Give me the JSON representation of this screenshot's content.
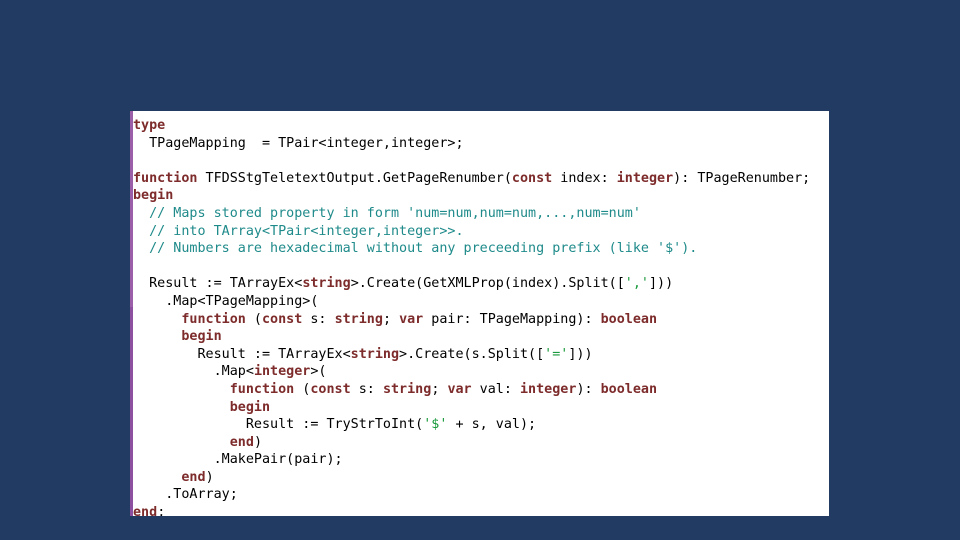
{
  "window": {
    "background_color": "#223b63",
    "panel_background_color": "#ffffff",
    "gutter_color": "#9a5fa8"
  },
  "theme": {
    "keyword_color": "#7d2b2b",
    "identifier_color": "#000000",
    "comment_color": "#1f8a8a",
    "string_color": "#1a9a3c"
  },
  "code": {
    "language": "Delphi / Object Pascal",
    "lines": [
      {
        "indent": 0,
        "tokens": [
          {
            "t": "type",
            "c": "kw"
          }
        ]
      },
      {
        "indent": 0,
        "tokens": [
          {
            "t": "  TPageMapping  = TPair<integer,integer>;",
            "c": "id"
          }
        ]
      },
      {
        "indent": 0,
        "tokens": [
          {
            "t": "",
            "c": "id"
          }
        ]
      },
      {
        "indent": 0,
        "tokens": [
          {
            "t": "function",
            "c": "kw"
          },
          {
            "t": " TFDSStgTeletextOutput.GetPageRenumber(",
            "c": "id"
          },
          {
            "t": "const",
            "c": "kw"
          },
          {
            "t": " index: ",
            "c": "id"
          },
          {
            "t": "integer",
            "c": "kw"
          },
          {
            "t": "): TPageRenumber;",
            "c": "id"
          }
        ]
      },
      {
        "indent": 0,
        "tokens": [
          {
            "t": "begin",
            "c": "kw"
          }
        ]
      },
      {
        "indent": 0,
        "tokens": [
          {
            "t": "  // Maps stored property in form 'num=num,num=num,...,num=num'",
            "c": "cmt"
          }
        ]
      },
      {
        "indent": 0,
        "tokens": [
          {
            "t": "  // into TArray<TPair<integer,integer>>.",
            "c": "cmt"
          }
        ]
      },
      {
        "indent": 0,
        "tokens": [
          {
            "t": "  // Numbers are hexadecimal without any preceeding prefix (like '$').",
            "c": "cmt"
          }
        ]
      },
      {
        "indent": 0,
        "tokens": [
          {
            "t": "",
            "c": "id"
          }
        ]
      },
      {
        "indent": 0,
        "tokens": [
          {
            "t": "  Result := TArrayEx<",
            "c": "id"
          },
          {
            "t": "string",
            "c": "kw"
          },
          {
            "t": ">.Create(GetXMLProp(index).Split([",
            "c": "id"
          },
          {
            "t": "','",
            "c": "str"
          },
          {
            "t": "]))",
            "c": "id"
          }
        ]
      },
      {
        "indent": 0,
        "tokens": [
          {
            "t": "    .Map<TPageMapping>(",
            "c": "id"
          }
        ]
      },
      {
        "indent": 0,
        "tokens": [
          {
            "t": "      ",
            "c": "id"
          },
          {
            "t": "function",
            "c": "kw"
          },
          {
            "t": " (",
            "c": "id"
          },
          {
            "t": "const",
            "c": "kw"
          },
          {
            "t": " s: ",
            "c": "id"
          },
          {
            "t": "string",
            "c": "kw"
          },
          {
            "t": "; ",
            "c": "id"
          },
          {
            "t": "var",
            "c": "kw"
          },
          {
            "t": " pair: TPageMapping): ",
            "c": "id"
          },
          {
            "t": "boolean",
            "c": "kw"
          }
        ]
      },
      {
        "indent": 0,
        "tokens": [
          {
            "t": "      ",
            "c": "id"
          },
          {
            "t": "begin",
            "c": "kw"
          }
        ]
      },
      {
        "indent": 0,
        "tokens": [
          {
            "t": "        Result := TArrayEx<",
            "c": "id"
          },
          {
            "t": "string",
            "c": "kw"
          },
          {
            "t": ">.Create(s.Split([",
            "c": "id"
          },
          {
            "t": "'='",
            "c": "str"
          },
          {
            "t": "]))",
            "c": "id"
          }
        ]
      },
      {
        "indent": 0,
        "tokens": [
          {
            "t": "          .Map<",
            "c": "id"
          },
          {
            "t": "integer",
            "c": "kw"
          },
          {
            "t": ">(",
            "c": "id"
          }
        ]
      },
      {
        "indent": 0,
        "tokens": [
          {
            "t": "            ",
            "c": "id"
          },
          {
            "t": "function",
            "c": "kw"
          },
          {
            "t": " (",
            "c": "id"
          },
          {
            "t": "const",
            "c": "kw"
          },
          {
            "t": " s: ",
            "c": "id"
          },
          {
            "t": "string",
            "c": "kw"
          },
          {
            "t": "; ",
            "c": "id"
          },
          {
            "t": "var",
            "c": "kw"
          },
          {
            "t": " val: ",
            "c": "id"
          },
          {
            "t": "integer",
            "c": "kw"
          },
          {
            "t": "): ",
            "c": "id"
          },
          {
            "t": "boolean",
            "c": "kw"
          }
        ]
      },
      {
        "indent": 0,
        "tokens": [
          {
            "t": "            ",
            "c": "id"
          },
          {
            "t": "begin",
            "c": "kw"
          }
        ]
      },
      {
        "indent": 0,
        "tokens": [
          {
            "t": "              Result := TryStrToInt(",
            "c": "id"
          },
          {
            "t": "'$'",
            "c": "str"
          },
          {
            "t": " + s, val);",
            "c": "id"
          }
        ]
      },
      {
        "indent": 0,
        "tokens": [
          {
            "t": "            ",
            "c": "id"
          },
          {
            "t": "end",
            "c": "kw"
          },
          {
            "t": ")",
            "c": "id"
          }
        ]
      },
      {
        "indent": 0,
        "tokens": [
          {
            "t": "          .MakePair(pair);",
            "c": "id"
          }
        ]
      },
      {
        "indent": 0,
        "tokens": [
          {
            "t": "      ",
            "c": "id"
          },
          {
            "t": "end",
            "c": "kw"
          },
          {
            "t": ")",
            "c": "id"
          }
        ]
      },
      {
        "indent": 0,
        "tokens": [
          {
            "t": "    .ToArray;",
            "c": "id"
          }
        ]
      },
      {
        "indent": 0,
        "tokens": [
          {
            "t": "end",
            "c": "kw"
          },
          {
            "t": ";",
            "c": "id"
          }
        ]
      }
    ]
  }
}
